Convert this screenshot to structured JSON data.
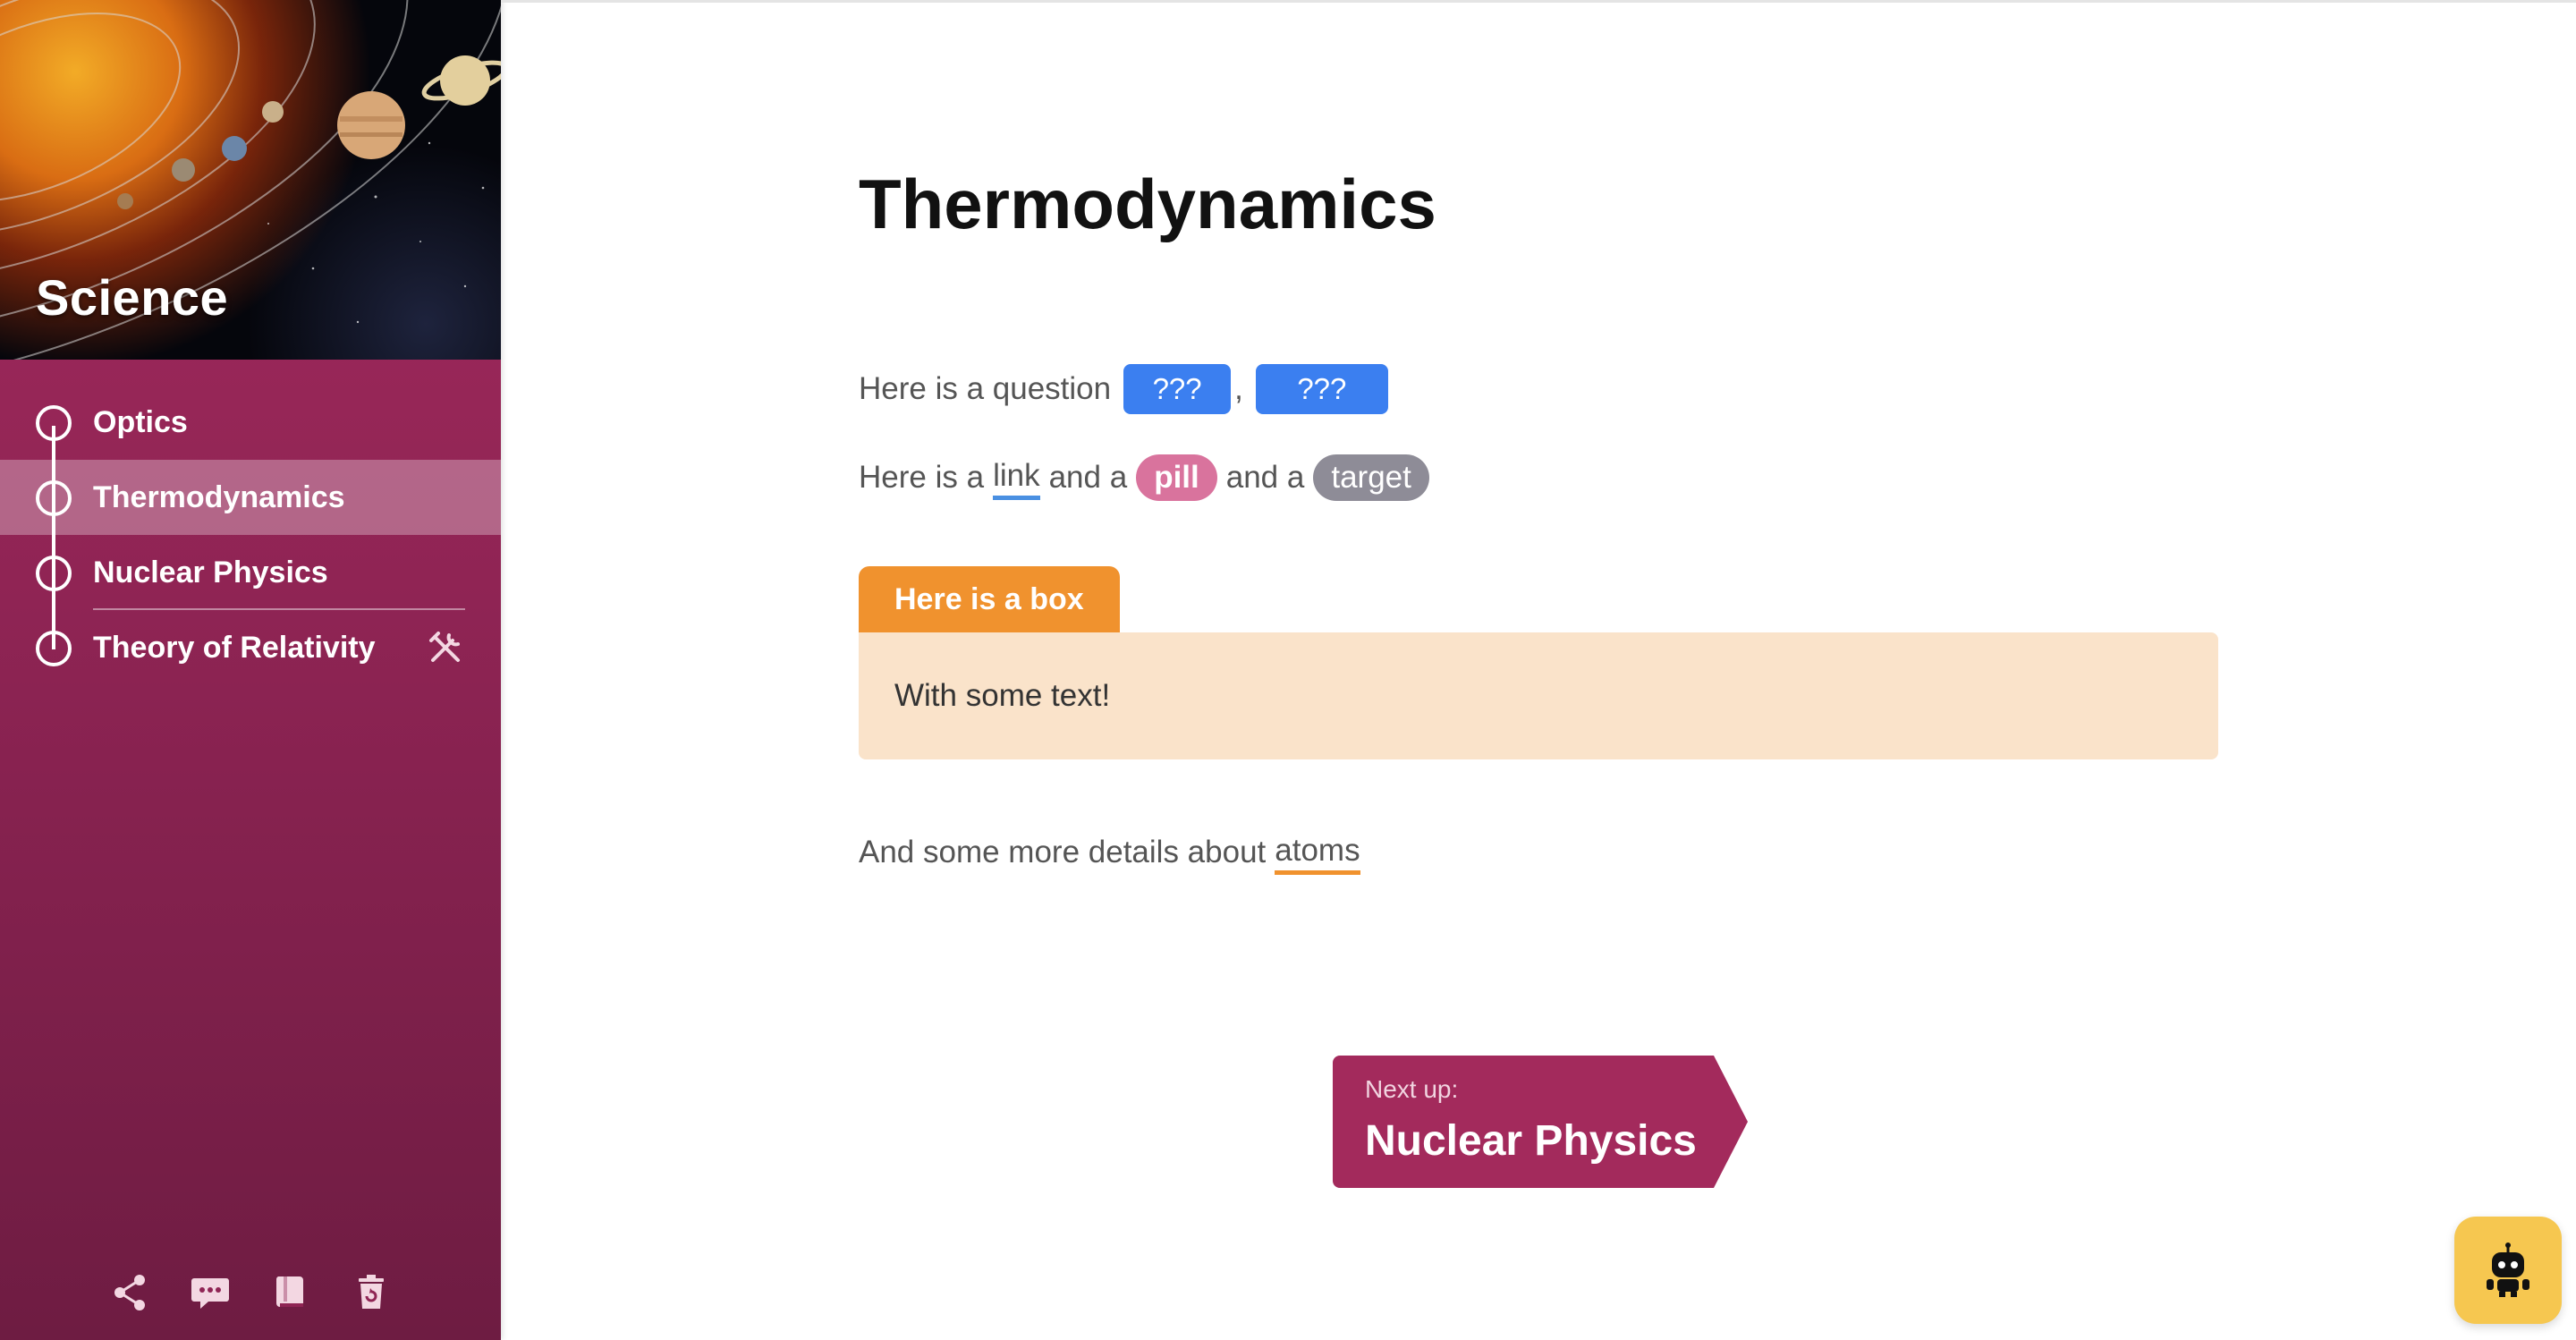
{
  "sidebar": {
    "course_title": "Science",
    "items": [
      {
        "label": "Optics",
        "active": false
      },
      {
        "label": "Thermodynamics",
        "active": true
      },
      {
        "label": "Nuclear Physics",
        "active": false
      },
      {
        "label": "Theory of Relativity",
        "active": false,
        "icon": "tools-icon"
      }
    ],
    "footer_icons": [
      "share-icon",
      "chat-icon",
      "book-icon",
      "reset-icon"
    ]
  },
  "main": {
    "title": "Thermodynamics",
    "question": {
      "prefix": "Here is a question",
      "blank1": "???",
      "separator": ",",
      "blank2": "???"
    },
    "line2": {
      "prefix": "Here is a",
      "link": "link",
      "and_a_1": "and a",
      "pill": "pill",
      "and_a_2": "and a",
      "target": "target"
    },
    "box": {
      "title": "Here is a box",
      "body": "With some text!"
    },
    "details": {
      "prefix": "And some more details about",
      "gloss": "atoms"
    },
    "next_up": {
      "label": "Next up:",
      "title": "Nuclear Physics"
    }
  },
  "colors": {
    "sidebar": "#a42a5d",
    "blank": "#3b7ff0",
    "pill": "#d9739d",
    "target": "#8e8c97",
    "box_tab": "#f0922e",
    "box_body": "#fae3ca",
    "next_button": "#a32a5c",
    "assistant": "#f6c750"
  },
  "assistant_icon": "robot-icon"
}
